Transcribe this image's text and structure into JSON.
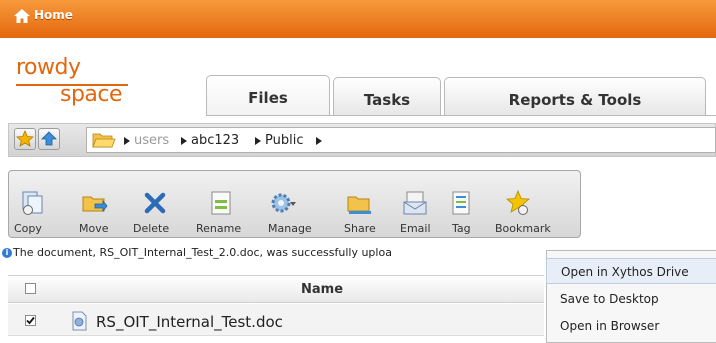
{
  "topbar": {
    "home_label": "Home"
  },
  "logo": {
    "line1": "rowdy",
    "line2": "space"
  },
  "tabs": [
    {
      "label": "Files",
      "active": true
    },
    {
      "label": "Tasks",
      "active": false
    },
    {
      "label": "Reports & Tools",
      "active": false
    }
  ],
  "breadcrumb": {
    "items": [
      {
        "label": "users",
        "dim": true
      },
      {
        "label": "abc123",
        "dim": false
      },
      {
        "label": "Public",
        "dim": false
      }
    ]
  },
  "toolbar": {
    "buttons": [
      {
        "label": "Copy",
        "icon": "copy-icon"
      },
      {
        "label": "Move",
        "icon": "move-icon"
      },
      {
        "label": "Delete",
        "icon": "delete-icon"
      },
      {
        "label": "Rename",
        "icon": "rename-icon"
      },
      {
        "label": "Manage",
        "icon": "gear-icon"
      },
      {
        "label": "Share",
        "icon": "share-icon"
      },
      {
        "label": "Email",
        "icon": "email-icon"
      },
      {
        "label": "Tag",
        "icon": "tag-icon"
      },
      {
        "label": "Bookmark",
        "icon": "bookmark-star-icon"
      }
    ]
  },
  "notice": {
    "text": "The document, RS_OIT_Internal_Test_2.0.doc, was successfully uploa"
  },
  "table": {
    "columns": {
      "name": "Name"
    },
    "rows": [
      {
        "name": "RS_OIT_Internal_Test.doc",
        "checked": true
      }
    ]
  },
  "context_menu": {
    "items": [
      {
        "label": "Open in Xythos Drive",
        "highlighted": true
      },
      {
        "label": "Save to Desktop",
        "highlighted": false
      },
      {
        "label": "Open in Browser",
        "highlighted": false
      }
    ]
  },
  "colors": {
    "brand_orange": "#e4670e",
    "topbar_light": "#f79a3c"
  }
}
